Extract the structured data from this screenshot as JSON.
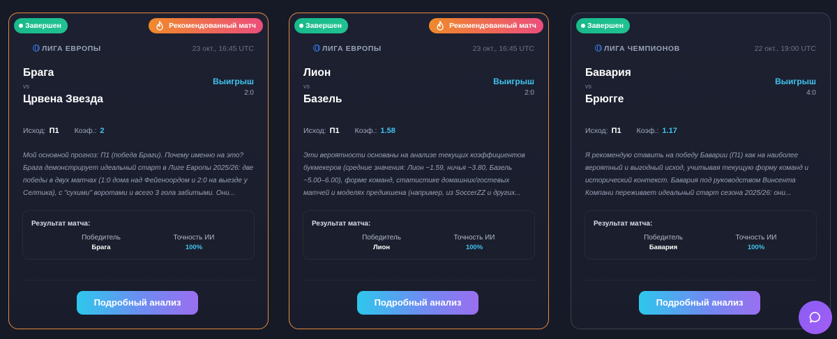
{
  "colors": {
    "accent_cyan": "#41c3f0",
    "status_green": "#21c292",
    "featured_border": "#e98a3e",
    "background": "#161a27"
  },
  "cards": [
    {
      "featured": true,
      "status": "Завершен",
      "recommended": "Рекомендованный матч",
      "league": "ЛИГА ЕВРОПЫ",
      "date": "23 окт., 16:45 UTC",
      "team1": "Брага",
      "vs": "vs",
      "team2": "Црвена Звезда",
      "outcome": "Выигрыш",
      "score": "2:0",
      "pick_label": "Исход:",
      "pick_value": "П1",
      "odds_label": "Коэф.:",
      "odds_value": "2",
      "analysis": "Мой основной прогноз: П1 (победа Браги). Почему именно на это? Брага демонстрирует идеальный старт в Лиге Европы 2025/26: две победы в двух матчах (1:0 дома над Фейеноордом и 2:0 на выезде у Селтика), с \"сухими\" воротами и всего 3 гола забитыми. Они...",
      "result_title": "Результат матча:",
      "winner_label": "Победитель",
      "winner_value": "Брага",
      "accuracy_label": "Точность ИИ",
      "accuracy_value": "100%",
      "button": "Подробный анализ"
    },
    {
      "featured": true,
      "status": "Завершен",
      "recommended": "Рекомендованный матч",
      "league": "ЛИГА ЕВРОПЫ",
      "date": "23 окт., 16:45 UTC",
      "team1": "Лион",
      "vs": "vs",
      "team2": "Базель",
      "outcome": "Выигрыш",
      "score": "2:0",
      "pick_label": "Исход:",
      "pick_value": "П1",
      "odds_label": "Коэф.:",
      "odds_value": "1.58",
      "analysis": "Эти вероятности основаны на анализе текущих коэффициентов букмекеров (средние значения: Лион ~1.59, ничья ~3.80, Базель ~5.00–6.00), форме команд, статистике домашних/гостевых матчей и моделях предикшена (например, из SoccerZZ и других...",
      "result_title": "Результат матча:",
      "winner_label": "Победитель",
      "winner_value": "Лион",
      "accuracy_label": "Точность ИИ",
      "accuracy_value": "100%",
      "button": "Подробный анализ"
    },
    {
      "featured": false,
      "status": "Завершен",
      "recommended": "",
      "league": "ЛИГА ЧЕМПИОНОВ",
      "date": "22 окт., 19:00 UTC",
      "team1": "Бавария",
      "vs": "vs",
      "team2": "Брюгге",
      "outcome": "Выигрыш",
      "score": "4:0",
      "pick_label": "Исход:",
      "pick_value": "П1",
      "odds_label": "Коэф.:",
      "odds_value": "1.17",
      "analysis": "Я рекомендую ставить на победу Баварии (П1) как на наиболее вероятный и выгодный исход, учитывая текущую форму команд и исторический контекст. Бавария под руководством Винсента Компани переживает идеальный старт сезона 2025/26: они...",
      "result_title": "Результат матча:",
      "winner_label": "Победитель",
      "winner_value": "Бавария",
      "accuracy_label": "Точность ИИ",
      "accuracy_value": "100%",
      "button": "Подробный анализ"
    }
  ],
  "chat": {
    "icon": "chat-bubble-icon"
  }
}
